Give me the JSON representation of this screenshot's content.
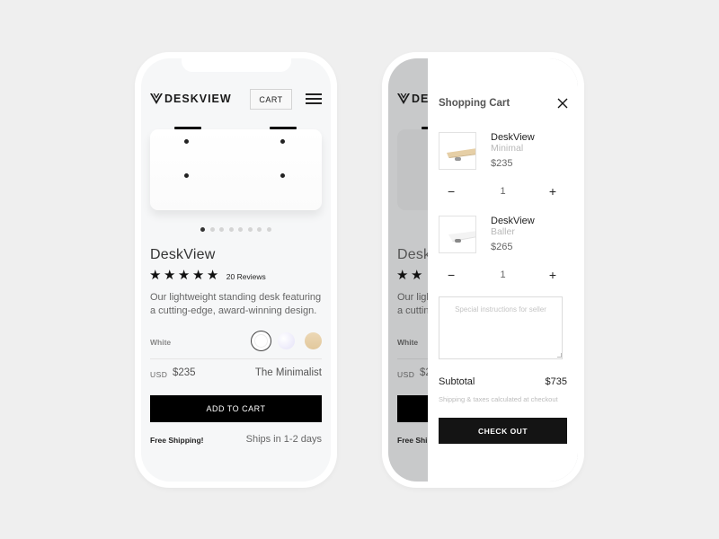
{
  "brand": {
    "name": "DESKVIEW"
  },
  "header": {
    "cart_label": "CART"
  },
  "product": {
    "title": "DeskView",
    "rating": 5,
    "rating_max": 5,
    "reviews_label": "20 Reviews",
    "description": "Our lightweight standing desk featuring a cutting-edge, award-winning design.",
    "color_label": "White",
    "colors": [
      {
        "name": "White",
        "hex": "#ffffff",
        "selected": true
      },
      {
        "name": "Lavender",
        "hex": "#e8e6f8",
        "selected": false
      },
      {
        "name": "Wood",
        "hex": "#e6cfa6",
        "selected": false
      }
    ],
    "currency": "USD",
    "price": "$235",
    "model": "The Minimalist",
    "add_to_cart_label": "ADD TO CART",
    "free_shipping_label": "Free Shipping!",
    "ships_in_label": "Ships in 1-2 days",
    "carousel": {
      "total": 8,
      "active_index": 0
    }
  },
  "cart": {
    "title": "Shopping Cart",
    "items": [
      {
        "name": "DeskView",
        "variant": "Minimal",
        "price": "$235",
        "quantity": "1",
        "minus": "−",
        "plus": "+"
      },
      {
        "name": "DeskView",
        "variant": "Baller",
        "price": "$265",
        "quantity": "1",
        "minus": "−",
        "plus": "+"
      }
    ],
    "notes_placeholder": "Special instructions for seller",
    "subtotal_label": "Subtotal",
    "subtotal_value": "$735",
    "shipping_note": "Shipping & taxes calculated at checkout",
    "checkout_label": "CHECK OUT"
  },
  "icons": {
    "star": "★",
    "close": "close-icon",
    "menu": "hamburger-icon",
    "logo": "deskview-logo-icon"
  }
}
